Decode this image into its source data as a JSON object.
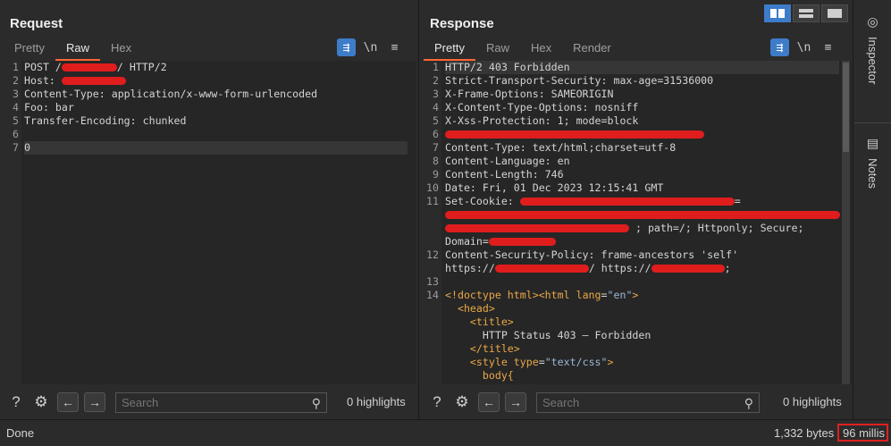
{
  "request": {
    "title": "Request",
    "tabs": [
      "Pretty",
      "Raw",
      "Hex"
    ],
    "active_tab": "Raw",
    "tools": {
      "wrap": "wrap-icon",
      "newline": "\\n",
      "menu": "menu-icon"
    },
    "lines": [
      {
        "n": "1",
        "parts": [
          [
            "t",
            "POST /"
          ],
          [
            "r",
            ""
          ],
          [
            "t",
            "/ HTTP/2"
          ]
        ]
      },
      {
        "n": "2",
        "parts": [
          [
            "t",
            "Host: "
          ],
          [
            "r",
            ""
          ]
        ]
      },
      {
        "n": "3",
        "parts": [
          [
            "t",
            "Content-Type: application/x-www-form-urlencoded"
          ]
        ]
      },
      {
        "n": "4",
        "parts": [
          [
            "t",
            "Foo: bar"
          ]
        ]
      },
      {
        "n": "5",
        "parts": [
          [
            "t",
            "Transfer-Encoding: chunked"
          ]
        ]
      },
      {
        "n": "6",
        "parts": []
      },
      {
        "n": "7",
        "parts": [
          [
            "t",
            "0"
          ]
        ]
      }
    ],
    "search_placeholder": "Search",
    "highlights": "0 highlights"
  },
  "response": {
    "title": "Response",
    "tabs": [
      "Pretty",
      "Raw",
      "Hex",
      "Render"
    ],
    "active_tab": "Pretty",
    "tools": {
      "wrap": "wrap-icon",
      "newline": "\\n",
      "menu": "menu-icon"
    },
    "gutter": [
      "1",
      "2",
      "3",
      "4",
      "5",
      "6",
      "7",
      "8",
      "9",
      "10",
      "11",
      "",
      "",
      "",
      "12",
      "",
      "13",
      "14",
      "",
      "",
      "",
      "",
      "",
      "",
      ""
    ],
    "lines": [
      [
        [
          "t",
          "HTTP/2 403 Forbidden"
        ]
      ],
      [
        [
          "t",
          "Strict-Transport-Security: max-age=31536000"
        ]
      ],
      [
        [
          "t",
          "X-Frame-Options: SAMEORIGIN"
        ]
      ],
      [
        [
          "t",
          "X-Content-Type-Options: nosniff"
        ]
      ],
      [
        [
          "t",
          "X-Xss-Protection: 1; mode=block"
        ]
      ],
      [
        [
          "r",
          ""
        ]
      ],
      [
        [
          "t",
          "Content-Type: text/html;charset=utf-8"
        ]
      ],
      [
        [
          "t",
          "Content-Language: en"
        ]
      ],
      [
        [
          "t",
          "Content-Length: 746"
        ]
      ],
      [
        [
          "t",
          "Date: Fri, 01 Dec 2023 12:15:41 GMT"
        ]
      ],
      [
        [
          "t",
          "Set-Cookie: "
        ],
        [
          "r",
          ""
        ],
        [
          "t",
          "="
        ]
      ],
      [
        [
          "r",
          ""
        ]
      ],
      [
        [
          "r",
          ""
        ],
        [
          "t",
          " ; path=/; Httponly; Secure;"
        ]
      ],
      [
        [
          "t",
          "Domain="
        ],
        [
          "r",
          ""
        ]
      ],
      [
        [
          "t",
          "Content-Security-Policy: frame-ancestors 'self'"
        ]
      ],
      [
        [
          "t",
          "https://"
        ],
        [
          "r",
          ""
        ],
        [
          "t",
          "/ https://"
        ],
        [
          "r",
          ""
        ],
        [
          "t",
          ";"
        ]
      ],
      [],
      [
        [
          "tag",
          "<!doctype html><html"
        ],
        [
          "t",
          " "
        ],
        [
          "attr",
          "lang"
        ],
        [
          "t",
          "="
        ],
        [
          "str",
          "\"en\""
        ],
        [
          "tag",
          ">"
        ]
      ],
      [
        [
          "t",
          "  "
        ],
        [
          "tag",
          "<head>"
        ]
      ],
      [
        [
          "t",
          "    "
        ],
        [
          "tag",
          "<title>"
        ]
      ],
      [
        [
          "t",
          "      HTTP Status 403 – Forbidden"
        ]
      ],
      [
        [
          "t",
          "    "
        ],
        [
          "tag",
          "</title>"
        ]
      ],
      [
        [
          "t",
          "    "
        ],
        [
          "tag",
          "<style"
        ],
        [
          "t",
          " "
        ],
        [
          "attr",
          "type"
        ],
        [
          "t",
          "="
        ],
        [
          "str",
          "\"text/css\""
        ],
        [
          "tag",
          ">"
        ]
      ],
      [
        [
          "t",
          "      "
        ],
        [
          "tag",
          "body{"
        ]
      ]
    ],
    "search_placeholder": "Search",
    "highlights": "0 highlights"
  },
  "side_tabs": [
    "Inspector",
    "Notes"
  ],
  "status": {
    "left": "Done",
    "bytes": "1,332 bytes",
    "millis": "96 millis"
  },
  "colors": {
    "accent": "#ff6633",
    "button_blue": "#3d7cc9",
    "redaction": "#e01d1d",
    "tag": "#e9a846",
    "string": "#9ab8d6"
  }
}
